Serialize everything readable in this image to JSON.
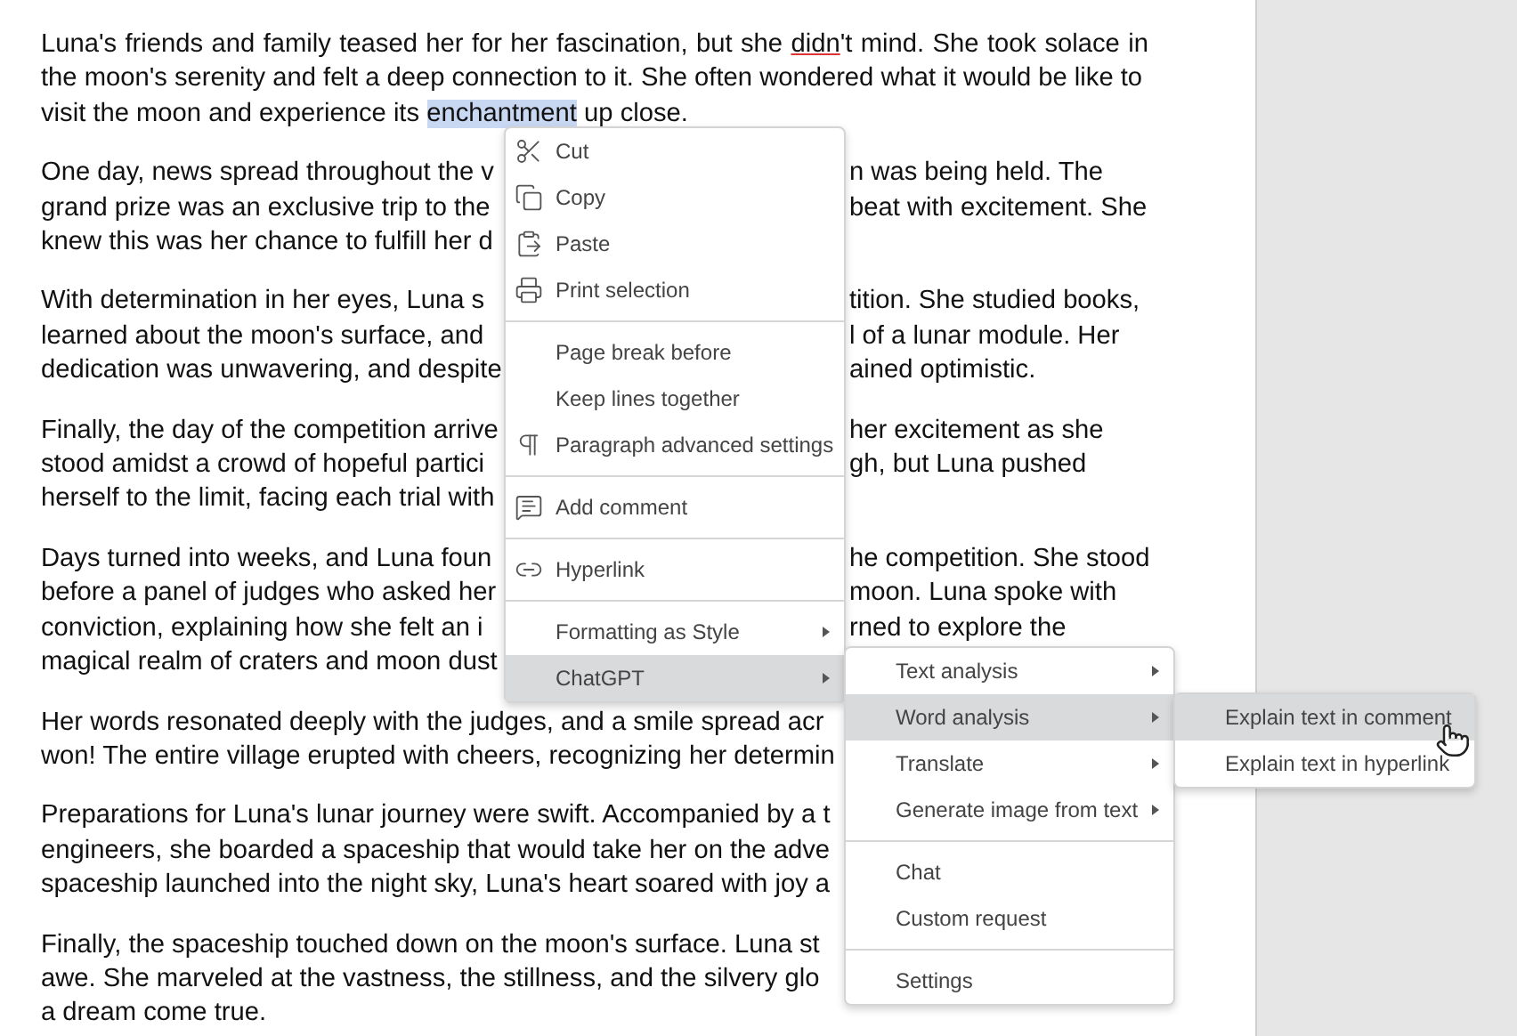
{
  "document": {
    "paragraphs": [
      {
        "lines": [
          {
            "parts": [
              {
                "text": "Luna's friends and family teased her for her fascination, but she ",
                "misspelled": false
              },
              {
                "text": "didn",
                "misspelled": true
              },
              {
                "text": "'t mind. She took solace in",
                "misspelled": false
              }
            ]
          },
          {
            "text": "the moon's serenity and felt a deep connection to it. She often wondered what it would be like to"
          },
          {
            "parts": [
              {
                "text": "visit the moon and experience its ",
                "selected": false
              },
              {
                "text": "enchantment",
                "selected": true
              },
              {
                "text": " up close.",
                "selected": false
              }
            ]
          }
        ]
      },
      {
        "lines": [
          {
            "text": "One day, news spread throughout the v",
            "right": "n was being held. The"
          },
          {
            "text": "grand prize was an exclusive trip to the",
            "right": "beat with excitement. She"
          },
          {
            "text": "knew this was her chance to fulfill her d"
          }
        ]
      },
      {
        "lines": [
          {
            "text": "With determination in her eyes, Luna s",
            "right": "tition. She studied books,"
          },
          {
            "text": "learned about the moon's surface, and",
            "right": "l of a lunar module. Her"
          },
          {
            "text": "dedication was unwavering, and despite",
            "right": "ained optimistic."
          }
        ]
      },
      {
        "lines": [
          {
            "text": "Finally, the day of the competition arrive",
            "right": "her excitement as she"
          },
          {
            "text": "stood amidst a crowd of hopeful partici",
            "right": "gh, but Luna pushed"
          },
          {
            "text": "herself to the limit, facing each trial with"
          }
        ]
      },
      {
        "lines": [
          {
            "text": "Days turned into weeks, and Luna foun",
            "right": "he competition. She stood"
          },
          {
            "text": "before a panel of judges who asked her",
            "right": "moon. Luna spoke with"
          },
          {
            "text": "conviction, explaining how she felt an i",
            "right": "rned to explore the"
          },
          {
            "text": "magical realm of craters and moon dust"
          }
        ]
      },
      {
        "lines": [
          {
            "text": "Her words resonated deeply with the judges, and a smile spread acr"
          },
          {
            "text": "won! The entire village erupted with cheers, recognizing her determin"
          }
        ]
      },
      {
        "lines": [
          {
            "text": "Preparations for Luna's lunar journey were swift. Accompanied by a t"
          },
          {
            "text": "engineers, she boarded a spaceship that would take her on the adve"
          },
          {
            "text": "spaceship launched into the night sky, Luna's heart soared with joy a"
          }
        ]
      },
      {
        "lines": [
          {
            "text": "Finally, the spaceship touched down on the moon's surface. Luna st"
          },
          {
            "text": "awe. She marveled at the vastness, the stillness, and the silvery glo"
          },
          {
            "text": "a dream come true."
          }
        ]
      }
    ]
  },
  "context_menu": {
    "groups": [
      [
        {
          "label": "Cut",
          "selected": false,
          "submenu": false
        },
        {
          "label": "Copy",
          "selected": false,
          "submenu": false
        },
        {
          "label": "Paste",
          "selected": false,
          "submenu": false
        },
        {
          "label": "Print selection",
          "selected": false,
          "submenu": false
        }
      ],
      [
        {
          "label": "Page break before",
          "selected": false,
          "submenu": false
        },
        {
          "label": "Keep lines together",
          "selected": false,
          "submenu": false
        },
        {
          "label": "Paragraph advanced settings",
          "selected": false,
          "submenu": false
        }
      ],
      [
        {
          "label": "Add comment",
          "selected": false,
          "submenu": false
        }
      ],
      [
        {
          "label": "Hyperlink",
          "selected": false,
          "submenu": false
        }
      ],
      [
        {
          "label": "Formatting as Style",
          "selected": false,
          "submenu": true
        },
        {
          "label": "ChatGPT",
          "selected": true,
          "submenu": true
        }
      ]
    ]
  },
  "chatgpt_menu": {
    "groups": [
      [
        {
          "label": "Text analysis",
          "selected": false,
          "submenu": true
        },
        {
          "label": "Word analysis",
          "selected": true,
          "submenu": true
        },
        {
          "label": "Translate",
          "selected": false,
          "submenu": true
        },
        {
          "label": "Generate image from text",
          "selected": false,
          "submenu": true
        }
      ],
      [
        {
          "label": "Chat",
          "selected": false,
          "submenu": false
        },
        {
          "label": "Custom request",
          "selected": false,
          "submenu": false
        }
      ],
      [
        {
          "label": "Settings",
          "selected": false,
          "submenu": false
        }
      ]
    ]
  },
  "word_analysis_menu": {
    "groups": [
      [
        {
          "label": "Explain text in comment",
          "selected": true,
          "submenu": false
        },
        {
          "label": "Explain text in hyperlink",
          "selected": false,
          "submenu": false
        }
      ]
    ]
  }
}
